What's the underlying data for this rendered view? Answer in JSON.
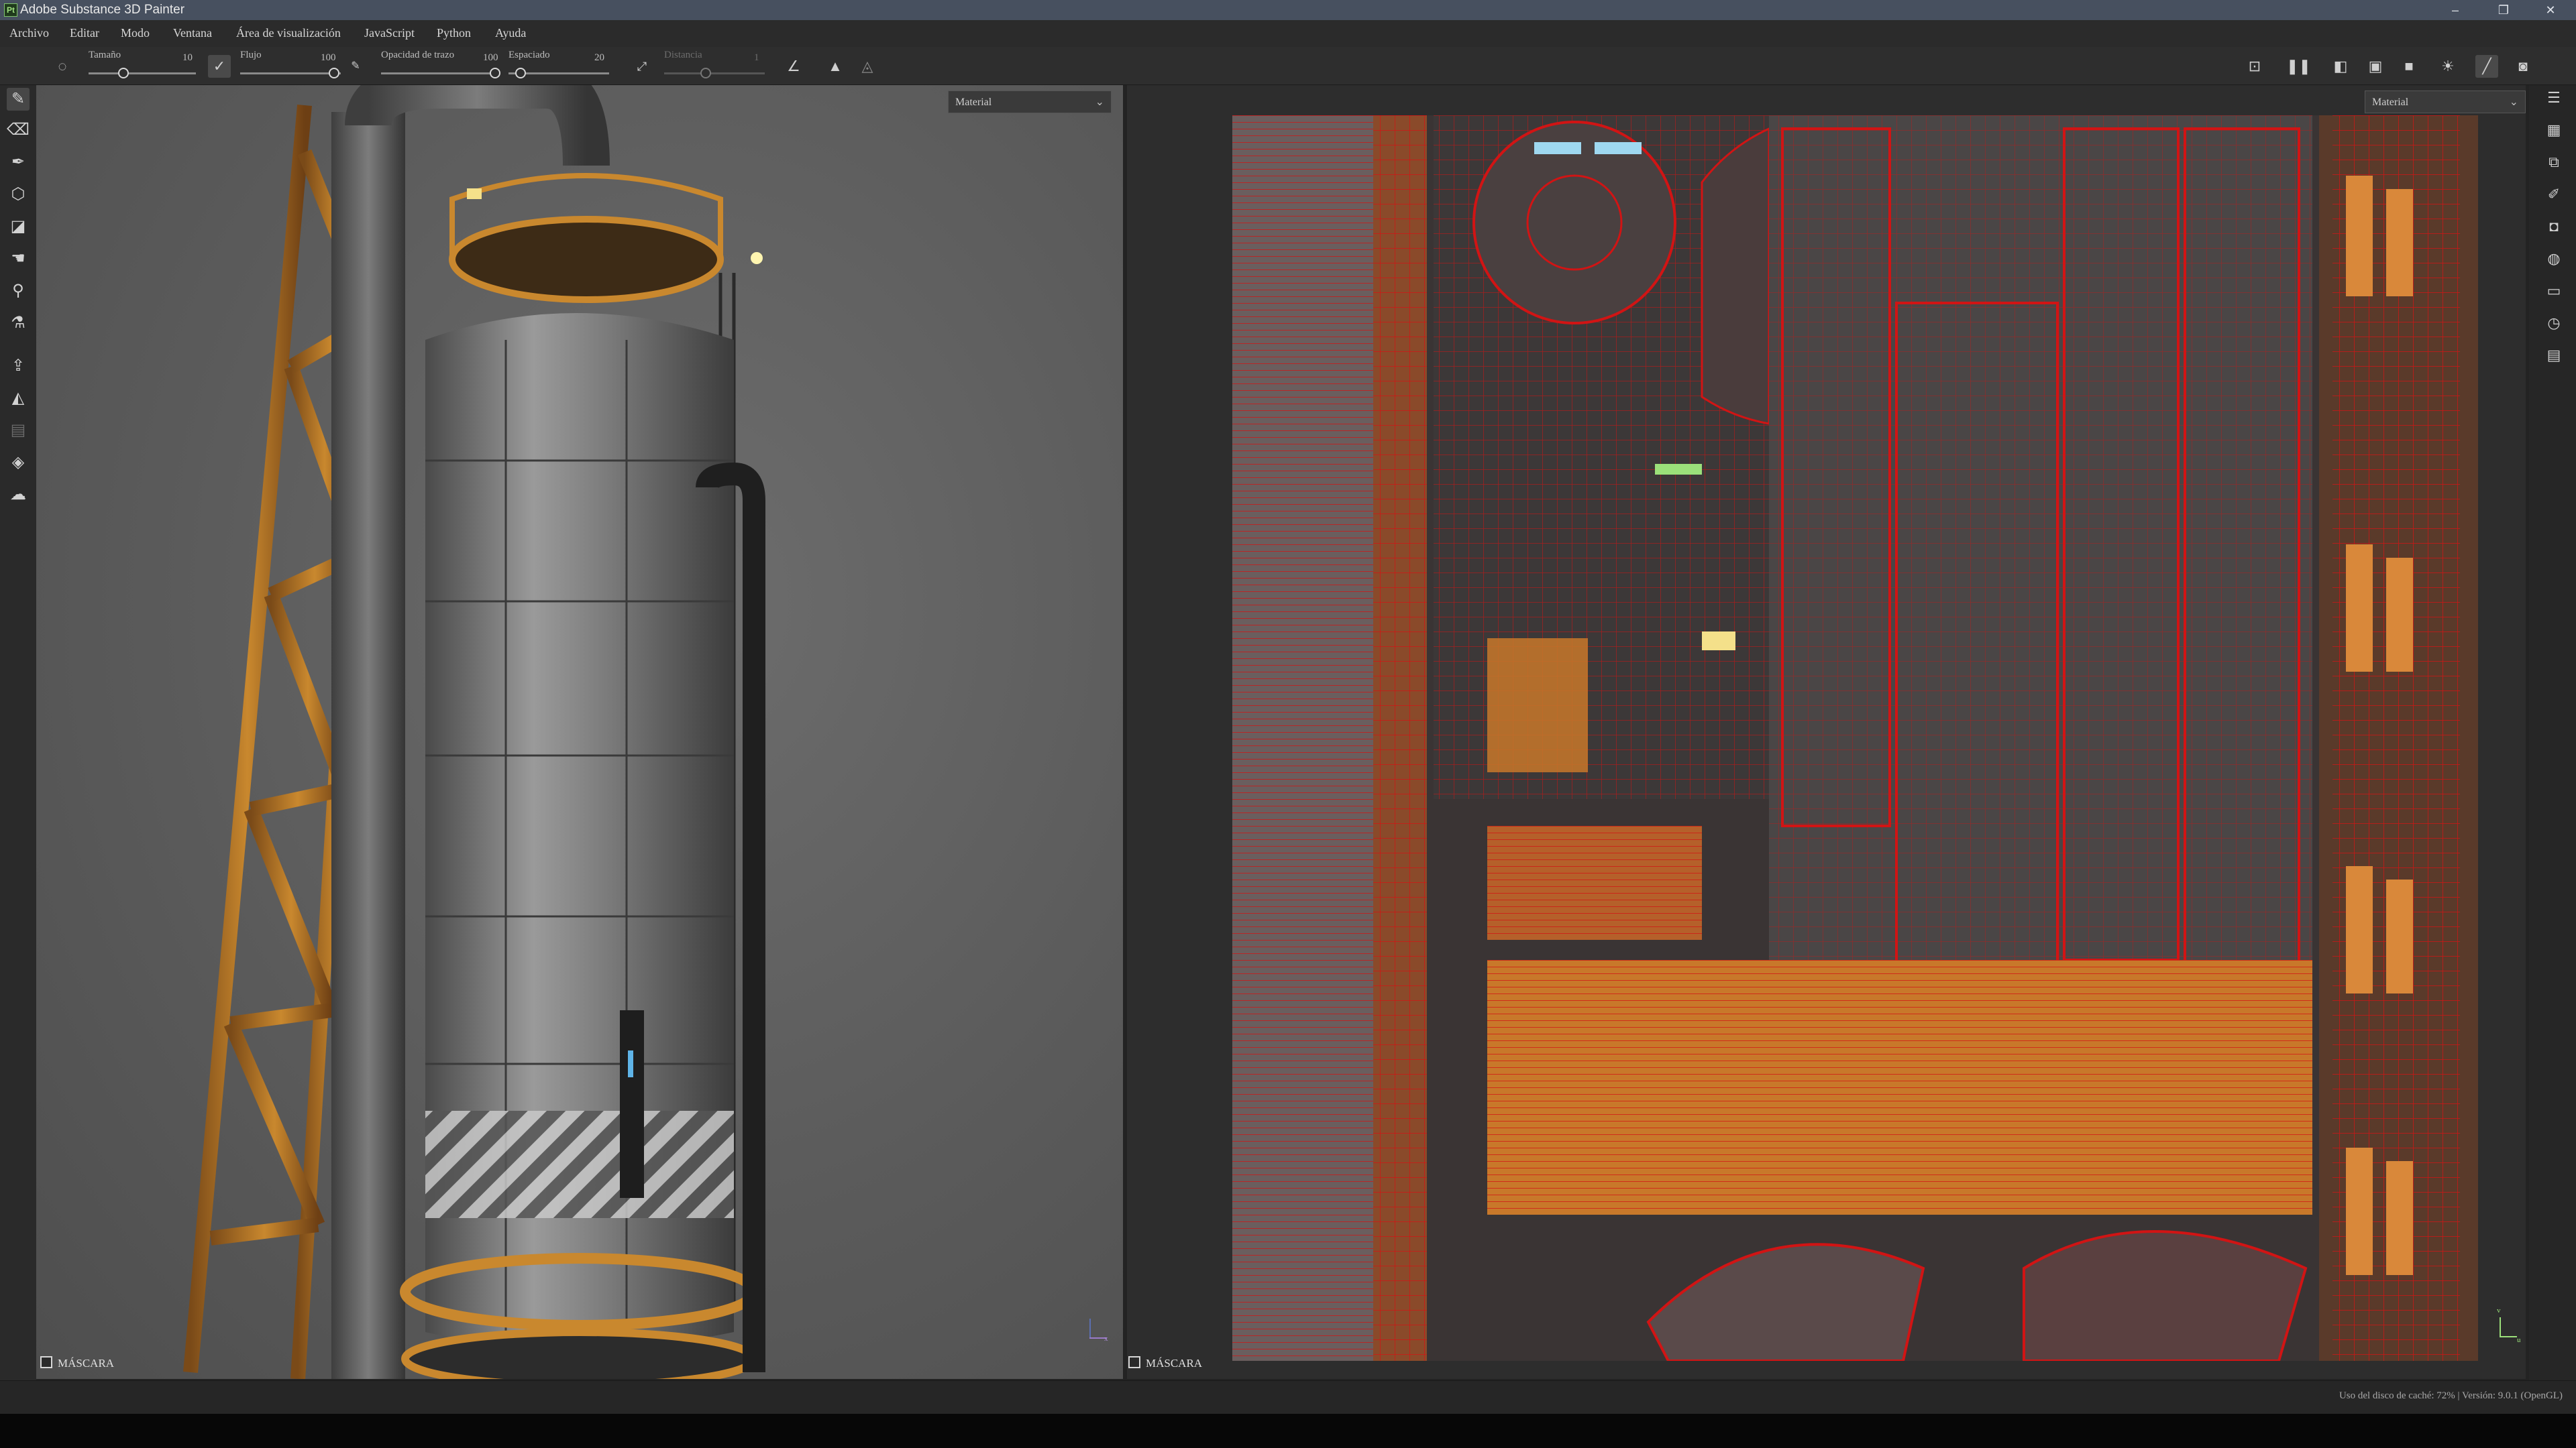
{
  "app": {
    "title": "Adobe Substance 3D Painter",
    "logo": "Pt"
  },
  "window_controls": {
    "minimize": "–",
    "restore": "❐",
    "close": "✕"
  },
  "menu": [
    "Archivo",
    "Editar",
    "Modo",
    "Ventana",
    "Área de visualización",
    "JavaScript",
    "Python",
    "Ayuda"
  ],
  "toolbar": {
    "size_label": "Tamaño",
    "size_value": "10",
    "flow_label": "Flujo",
    "flow_value": "100",
    "stroke_opacity_label": "Opacidad de trazo",
    "stroke_opacity_value": "100",
    "spacing_label": "Espaciado",
    "spacing_value": "20",
    "distance_label": "Distancia",
    "distance_value": "1",
    "right_icons": [
      "snapshot-icon",
      "pause-icon",
      "split-view-icon",
      "3d-view-icon",
      "camera-icon",
      "lighting-icon",
      "brush-icon",
      "screenshot-icon"
    ]
  },
  "left_tools": [
    "paint-brush-icon",
    "eraser-icon",
    "projection-icon",
    "geometry-fill-icon",
    "polygon-fill-icon",
    "smudge-icon",
    "clone-icon",
    "color-picker-icon",
    "bake-icon",
    "quick-mask-icon",
    "layer-select-icon",
    "material-picker-icon",
    "texture-set-icon"
  ],
  "viewport3d": {
    "mode_dropdown": "Material",
    "mask_label": "MÁSCARA",
    "axis_label": "x"
  },
  "viewport2d": {
    "mode_dropdown": "Material",
    "mask_label": "MÁSCARA",
    "axis_v": "v",
    "axis_u": "u"
  },
  "right_panel_icons": [
    "layers-panel-icon",
    "texture-set-panel-icon",
    "stack-icon",
    "brush-panel-icon",
    "display-settings-icon",
    "shader-icon",
    "assets-icon",
    "history-icon",
    "log-icon"
  ],
  "status": {
    "text": "Uso del disco de caché:   72% | Versión: 9.0.1 (OpenGL)"
  },
  "colors": {
    "uv_wire": "#d11414",
    "rust": "#c8782a",
    "steel": "#8a8a8a",
    "highlight_green": "#9be07a",
    "highlight_yellow": "#f4e08a",
    "highlight_cyan": "#9fd8f0"
  }
}
